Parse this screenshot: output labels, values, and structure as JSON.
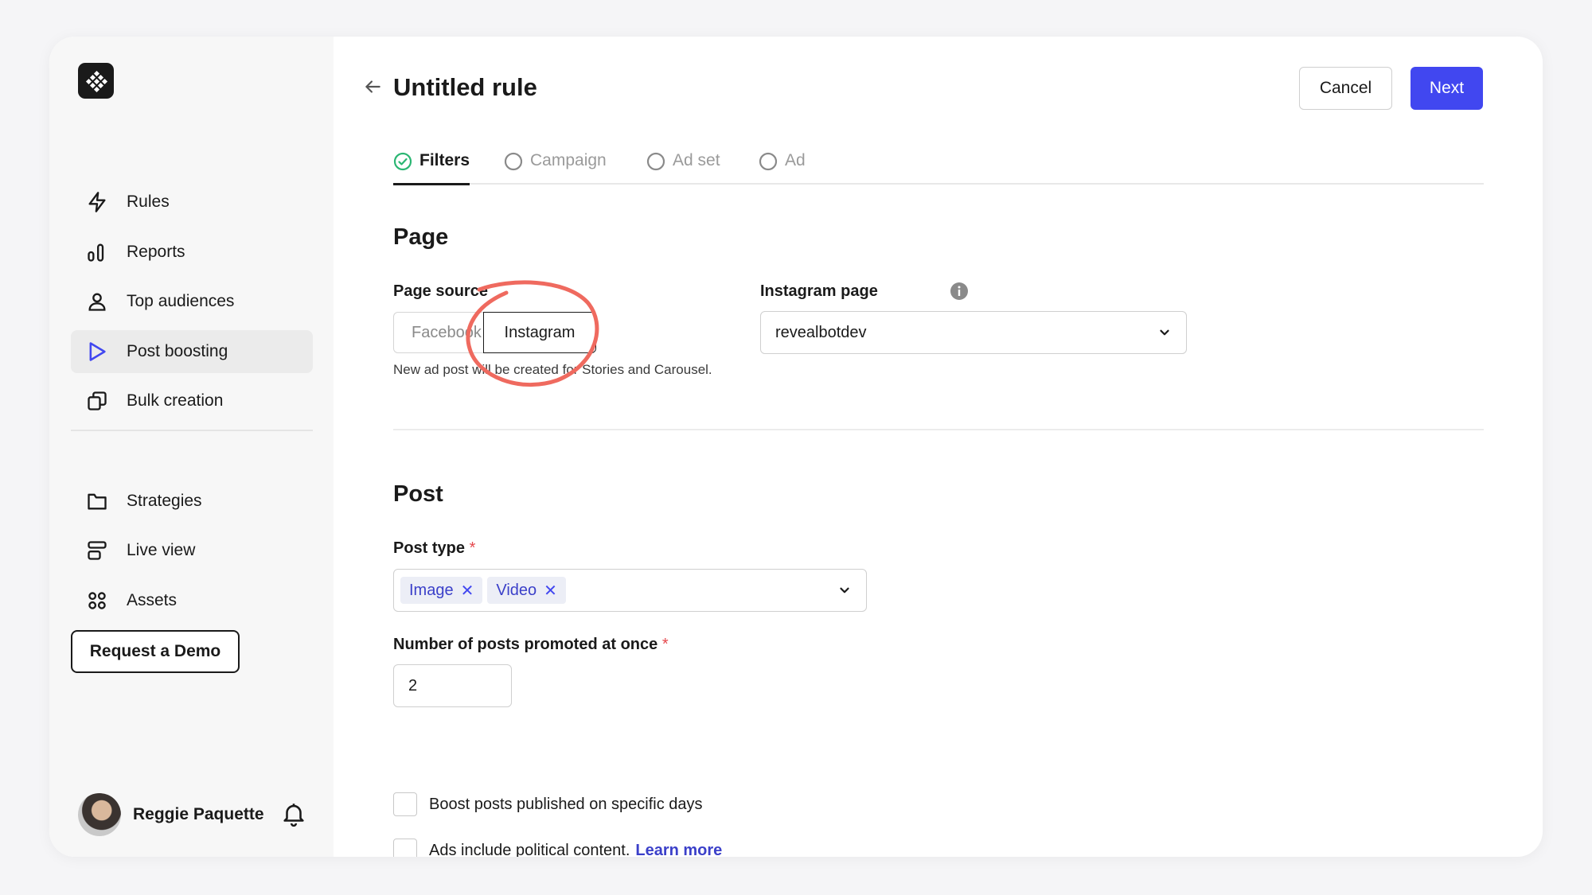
{
  "sidebar": {
    "nav_primary": [
      {
        "label": "Rules",
        "icon": "lightning-icon"
      },
      {
        "label": "Reports",
        "icon": "bar-chart-icon"
      },
      {
        "label": "Top audiences",
        "icon": "person-icon"
      },
      {
        "label": "Post boosting",
        "icon": "play-icon",
        "active": true
      },
      {
        "label": "Bulk creation",
        "icon": "copy-icon"
      }
    ],
    "nav_secondary": [
      {
        "label": "Strategies",
        "icon": "folder-icon"
      },
      {
        "label": "Live view",
        "icon": "live-view-icon"
      },
      {
        "label": "Assets",
        "icon": "grid-icon"
      }
    ],
    "demo_button": "Request a Demo",
    "user_name": "Reggie Paquette"
  },
  "header": {
    "title": "Untitled rule",
    "cancel_label": "Cancel",
    "next_label": "Next"
  },
  "tabs": [
    {
      "label": "Filters",
      "state": "complete"
    },
    {
      "label": "Campaign",
      "state": "pending"
    },
    {
      "label": "Ad set",
      "state": "pending"
    },
    {
      "label": "Ad",
      "state": "pending"
    }
  ],
  "page_section": {
    "title": "Page",
    "source_label": "Page source",
    "source_options": [
      "Facebook",
      "Instagram"
    ],
    "source_selected": "Instagram",
    "help_text": "New ad post will be created for Stories and Carousel.",
    "instagram_label": "Instagram page",
    "instagram_value": "revealbotdev"
  },
  "post_section": {
    "title": "Post",
    "type_label": "Post type",
    "required_mark": "*",
    "types": [
      "Image",
      "Video"
    ],
    "count_label": "Number of posts promoted at once",
    "count_value": "2",
    "check_days": "Boost posts published on specific days",
    "check_political": "Ads include political content.",
    "learn_more": "Learn more"
  },
  "colors": {
    "accent": "#4147f0",
    "success": "#2bb673",
    "annotation": "#ef6a5f",
    "required": "#e5484d"
  }
}
